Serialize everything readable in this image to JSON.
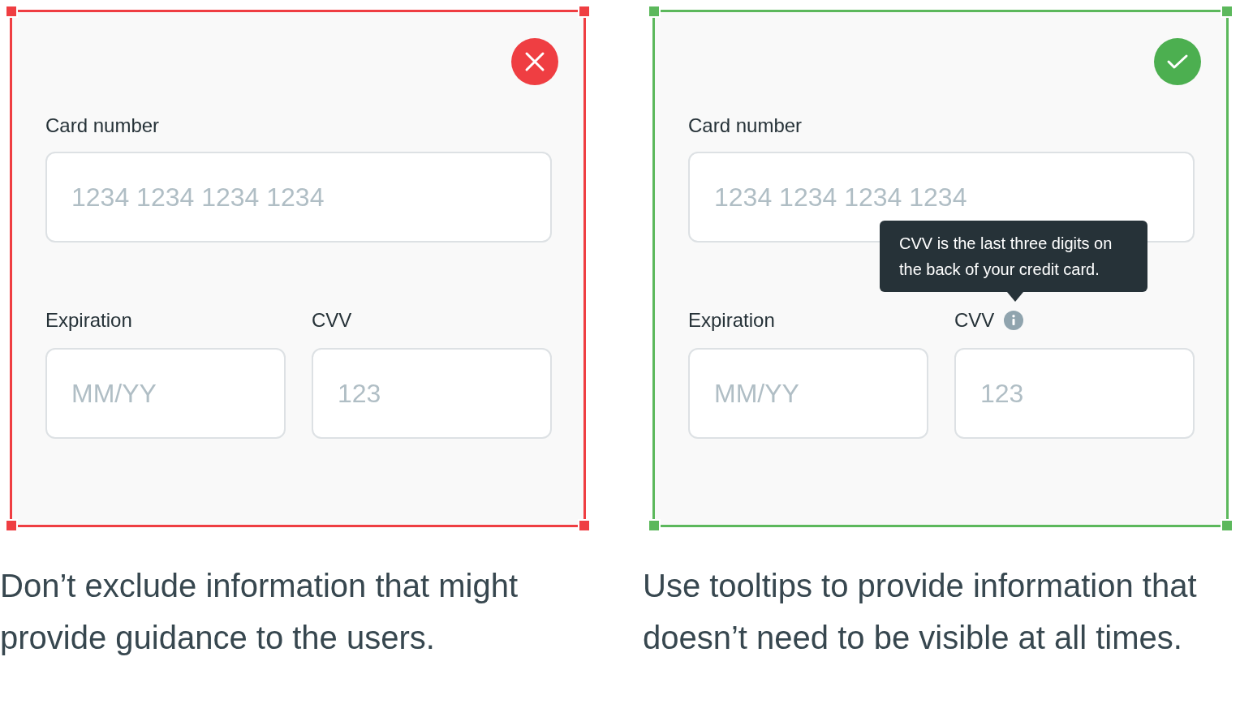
{
  "panels": [
    {
      "kind": "dont",
      "card_label": "Card number",
      "card_placeholder": "1234 1234 1234 1234",
      "expiration_label": "Expiration",
      "expiration_placeholder": "MM/YY",
      "cvv_label": "CVV",
      "cvv_placeholder": "123",
      "caption": "Don’t exclude information that might provide guidance to the users."
    },
    {
      "kind": "do",
      "card_label": "Card number",
      "card_placeholder": "1234 1234 1234 1234",
      "expiration_label": "Expiration",
      "expiration_placeholder": "MM/YY",
      "cvv_label": "CVV",
      "cvv_placeholder": "123",
      "tooltip": "CVV is the last three digits on the back of your credit card.",
      "caption": "Use tooltips to provide information that doesn’t need to be visible at all times."
    }
  ]
}
